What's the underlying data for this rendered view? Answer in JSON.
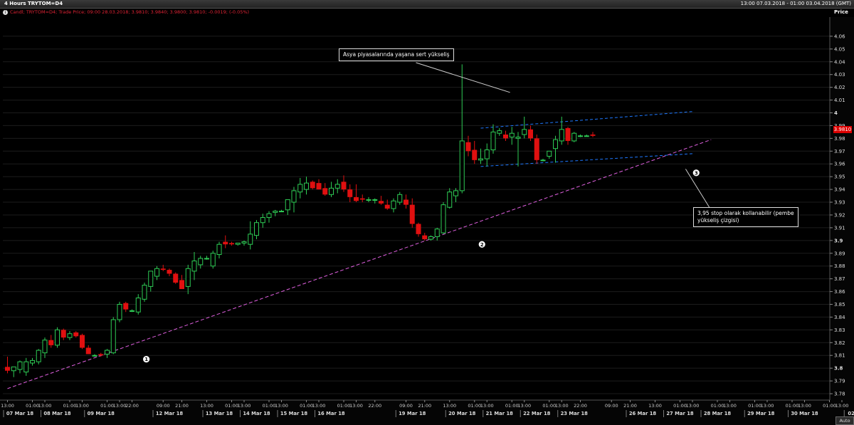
{
  "window": {
    "title": "4 Hours TRYTOM=D4",
    "range": "13:00 07.03.2018 - 01:00 03.04.2018 (GMT)"
  },
  "info_line": "Candl; TRYTOM=D4; Trade Price; 09:00 28.03.2018; 3.9810; 3.9840; 3.9800; 3.9810; -0.0019; (-0.05%)",
  "price_axis_label": "Price",
  "auto_button": "Auto",
  "last_price_label": "3.9810",
  "colors": {
    "up": "#2ecc55",
    "down": "#e01010",
    "trend": "#e060e0",
    "channel": "#1e78ff",
    "grid": "#1c1c1c"
  },
  "annotations": [
    {
      "text": "Asya piyasalarında yaşana sert yükseliş"
    },
    {
      "text": "3,95 stop olarak kollanabilir (pembe yükseliş çizgisi)"
    }
  ],
  "markers": [
    "1",
    "2",
    "3"
  ],
  "chart_data": {
    "type": "candlestick",
    "title": "4 Hours TRYTOM=D4",
    "xlabel": "",
    "ylabel": "Price",
    "ylim": [
      3.775,
      4.075
    ],
    "yticks": [
      3.78,
      3.79,
      3.8,
      3.81,
      3.82,
      3.83,
      3.84,
      3.85,
      3.86,
      3.87,
      3.88,
      3.89,
      3.9,
      3.91,
      3.92,
      3.93,
      3.94,
      3.95,
      3.96,
      3.97,
      3.98,
      3.99,
      4,
      4.01,
      4.02,
      4.03,
      4.04,
      4.05,
      4.06
    ],
    "ytick_labels": [
      "3.78",
      "3.79",
      "3.8",
      "3.81",
      "3.82",
      "3.83",
      "3.84",
      "3.85",
      "3.86",
      "3.87",
      "3.88",
      "3.89",
      "3.9",
      "3.91",
      "3.92",
      "3.93",
      "3.94",
      "3.95",
      "3.96",
      "3.97",
      "3.98",
      "3.99",
      "4",
      "4.01",
      "4.02",
      "4.03",
      "4.04",
      "4.05",
      "4.06"
    ],
    "x_time_labels": [
      [
        "13:00",
        0
      ],
      [
        "01:00",
        4
      ],
      [
        "13:00",
        6
      ],
      [
        "01:00",
        10
      ],
      [
        "13:00",
        12
      ],
      [
        "01:00",
        16
      ],
      [
        "13:00",
        18
      ],
      [
        "22:00",
        20
      ],
      [
        "09:00",
        25
      ],
      [
        "21:00",
        28
      ],
      [
        "13:00",
        32
      ],
      [
        "01:00",
        36
      ],
      [
        "13:00",
        38
      ],
      [
        "01:00",
        42
      ],
      [
        "13:00",
        44
      ],
      [
        "01:00",
        48
      ],
      [
        "13:00",
        50
      ],
      [
        "01:00",
        54
      ],
      [
        "13:00",
        56
      ],
      [
        "22:00",
        59
      ],
      [
        "09:00",
        64
      ],
      [
        "21:00",
        67
      ],
      [
        "13:00",
        71
      ],
      [
        "01:00",
        75
      ],
      [
        "13:00",
        77
      ],
      [
        "01:00",
        81
      ],
      [
        "13:00",
        83
      ],
      [
        "01:00",
        87
      ],
      [
        "13:00",
        89
      ],
      [
        "22:00",
        92
      ],
      [
        "09:00",
        97
      ],
      [
        "21:00",
        100
      ],
      [
        "13:00",
        104
      ],
      [
        "01:00",
        108
      ],
      [
        "13:00",
        110
      ],
      [
        "01:00",
        114
      ],
      [
        "13:00",
        116
      ],
      [
        "01:00",
        120
      ],
      [
        "13:00",
        122
      ],
      [
        "01:00",
        126
      ],
      [
        "13:00",
        128
      ],
      [
        "01:00",
        132
      ],
      [
        "13:00",
        134
      ],
      [
        "09:00",
        143
      ]
    ],
    "x_date_labels": [
      [
        "07 Mar 18",
        2
      ],
      [
        "08 Mar 18",
        8
      ],
      [
        "09 Mar 18",
        15
      ],
      [
        "12 Mar 18",
        26
      ],
      [
        "13 Mar 18",
        34
      ],
      [
        "14 Mar 18",
        40
      ],
      [
        "15 Mar 18",
        46
      ],
      [
        "16 Mar 18",
        52
      ],
      [
        "19 Mar 18",
        65
      ],
      [
        "20 Mar 18",
        73
      ],
      [
        "21 Mar 18",
        79
      ],
      [
        "22 Mar 18",
        85
      ],
      [
        "23 Mar 18",
        91
      ],
      [
        "26 Mar 18",
        102
      ],
      [
        "27 Mar 18",
        108
      ],
      [
        "28 Mar 18",
        114
      ],
      [
        "29 Mar 18",
        121
      ],
      [
        "30 Mar 18",
        128
      ],
      [
        "02 Nis 18",
        137
      ]
    ],
    "candles": [
      [
        3.801,
        3.809,
        3.796,
        3.798
      ],
      [
        3.798,
        3.801,
        3.793,
        3.801
      ],
      [
        3.799,
        3.806,
        3.796,
        3.805
      ],
      [
        3.797,
        3.808,
        3.794,
        3.805
      ],
      [
        3.804,
        3.808,
        3.802,
        3.806
      ],
      [
        3.805,
        3.815,
        3.803,
        3.814
      ],
      [
        3.812,
        3.824,
        3.808,
        3.822
      ],
      [
        3.822,
        3.826,
        3.816,
        3.818
      ],
      [
        3.818,
        3.832,
        3.816,
        3.83
      ],
      [
        3.83,
        3.831,
        3.822,
        3.824
      ],
      [
        3.824,
        3.829,
        3.822,
        3.827
      ],
      [
        3.828,
        3.829,
        3.824,
        3.825
      ],
      [
        3.826,
        3.827,
        3.815,
        3.816
      ],
      [
        3.816,
        3.818,
        3.811,
        3.811
      ],
      [
        3.81,
        3.811,
        3.809,
        3.81
      ],
      [
        3.811,
        3.812,
        3.809,
        3.81
      ],
      [
        3.811,
        3.815,
        3.808,
        3.814
      ],
      [
        3.812,
        3.84,
        3.811,
        3.838
      ],
      [
        3.838,
        3.852,
        3.836,
        3.85
      ],
      [
        3.851,
        3.852,
        3.844,
        3.846
      ],
      [
        3.845,
        3.846,
        3.844,
        3.845
      ],
      [
        3.844,
        3.858,
        3.842,
        3.855
      ],
      [
        3.854,
        3.867,
        3.852,
        3.865
      ],
      [
        3.864,
        3.876,
        3.86,
        3.876
      ],
      [
        3.872,
        3.88,
        3.869,
        3.878
      ],
      [
        3.878,
        3.881,
        3.876,
        3.877
      ],
      [
        3.877,
        3.878,
        3.872,
        3.874
      ],
      [
        3.874,
        3.875,
        3.866,
        3.867
      ],
      [
        3.869,
        3.873,
        3.862,
        3.862
      ],
      [
        3.864,
        3.881,
        3.858,
        3.878
      ],
      [
        3.876,
        3.891,
        3.869,
        3.884
      ],
      [
        3.881,
        3.888,
        3.878,
        3.886
      ],
      [
        3.886,
        3.888,
        3.885,
        3.886
      ],
      [
        3.88,
        3.892,
        3.878,
        3.89
      ],
      [
        3.889,
        3.899,
        3.886,
        3.897
      ],
      [
        3.899,
        3.904,
        3.894,
        3.897
      ],
      [
        3.898,
        3.899,
        3.896,
        3.897
      ],
      [
        3.897,
        3.898,
        3.896,
        3.898
      ],
      [
        3.898,
        3.9,
        3.896,
        3.899
      ],
      [
        3.897,
        3.915,
        3.893,
        3.905
      ],
      [
        3.904,
        3.916,
        3.901,
        3.914
      ],
      [
        3.914,
        3.921,
        3.91,
        3.918
      ],
      [
        3.918,
        3.923,
        3.914,
        3.921
      ],
      [
        3.922,
        3.924,
        3.919,
        3.923
      ],
      [
        3.923,
        3.924,
        3.923,
        3.923
      ],
      [
        3.924,
        3.932,
        3.92,
        3.932
      ],
      [
        3.93,
        3.942,
        3.922,
        3.939
      ],
      [
        3.938,
        3.949,
        3.933,
        3.944
      ],
      [
        3.94,
        3.95,
        3.936,
        3.945
      ],
      [
        3.946,
        3.947,
        3.94,
        3.941
      ],
      [
        3.945,
        3.948,
        3.94,
        3.94
      ],
      [
        3.941,
        3.945,
        3.935,
        3.936
      ],
      [
        3.936,
        3.946,
        3.934,
        3.941
      ],
      [
        3.941,
        3.948,
        3.937,
        3.944
      ],
      [
        3.946,
        3.951,
        3.938,
        3.94
      ],
      [
        3.94,
        3.944,
        3.93,
        3.934
      ],
      [
        3.934,
        3.944,
        3.93,
        3.931
      ],
      [
        3.933,
        3.936,
        3.93,
        3.932
      ],
      [
        3.932,
        3.934,
        3.93,
        3.932
      ],
      [
        3.932,
        3.933,
        3.929,
        3.932
      ],
      [
        3.931,
        3.935,
        3.928,
        3.929
      ],
      [
        3.928,
        3.932,
        3.924,
        3.925
      ],
      [
        3.925,
        3.933,
        3.922,
        3.931
      ],
      [
        3.93,
        3.938,
        3.928,
        3.936
      ],
      [
        3.932,
        3.936,
        3.925,
        3.928
      ],
      [
        3.928,
        3.933,
        3.91,
        3.913
      ],
      [
        3.913,
        3.914,
        3.903,
        3.905
      ],
      [
        3.904,
        3.906,
        3.9,
        3.901
      ],
      [
        3.901,
        3.904,
        3.9,
        3.903
      ],
      [
        3.903,
        3.91,
        3.9,
        3.909
      ],
      [
        3.906,
        3.93,
        3.905,
        3.928
      ],
      [
        3.926,
        3.941,
        3.925,
        3.938
      ],
      [
        3.935,
        3.941,
        3.93,
        3.939
      ],
      [
        3.939,
        4.038,
        3.937,
        3.978
      ],
      [
        3.977,
        3.982,
        3.966,
        3.97
      ],
      [
        3.971,
        3.978,
        3.96,
        3.963
      ],
      [
        3.963,
        3.972,
        3.96,
        3.964
      ],
      [
        3.964,
        3.976,
        3.958,
        3.971
      ],
      [
        3.971,
        3.991,
        3.968,
        3.985
      ],
      [
        3.984,
        3.988,
        3.982,
        3.986
      ],
      [
        3.983,
        3.986,
        3.978,
        3.98
      ],
      [
        3.981,
        3.989,
        3.975,
        3.984
      ],
      [
        3.98,
        3.985,
        3.958,
        3.981
      ],
      [
        3.983,
        3.997,
        3.98,
        3.987
      ],
      [
        3.987,
        3.99,
        3.978,
        3.98
      ],
      [
        3.98,
        3.983,
        3.96,
        3.963
      ],
      [
        3.963,
        3.964,
        3.962,
        3.963
      ],
      [
        3.966,
        3.97,
        3.964,
        3.97
      ],
      [
        3.972,
        3.982,
        3.961,
        3.979
      ],
      [
        3.978,
        3.997,
        3.975,
        3.987
      ],
      [
        3.988,
        3.989,
        3.975,
        3.978
      ],
      [
        3.978,
        3.985,
        3.977,
        3.984
      ],
      [
        3.982,
        3.983,
        3.981,
        3.982
      ],
      [
        3.982,
        3.983,
        3.982,
        3.982
      ],
      [
        3.983,
        3.985,
        3.981,
        3.982
      ]
    ],
    "candle_slots": [
      0,
      1,
      2,
      3,
      4,
      5,
      6,
      7,
      8,
      9,
      10,
      11,
      12,
      13,
      14,
      15,
      16,
      17,
      18,
      19,
      20,
      21,
      22,
      23,
      24,
      25,
      26,
      27,
      28,
      29,
      30,
      31,
      32,
      33,
      34,
      35,
      36,
      37,
      38,
      39,
      40,
      41,
      42,
      43,
      44,
      45,
      46,
      47,
      48,
      49,
      50,
      51,
      52,
      53,
      54,
      55,
      56,
      57,
      58,
      59,
      60,
      61,
      62,
      63,
      64,
      65,
      66,
      67,
      68,
      69,
      70,
      71,
      72,
      73,
      74,
      75,
      76,
      77,
      78,
      79,
      80,
      81,
      82,
      83,
      84,
      85,
      86,
      87,
      88,
      89,
      90,
      91,
      92,
      93,
      94
    ],
    "trendline": {
      "from": [
        0,
        3.784
      ],
      "to": [
        113,
        3.979
      ]
    },
    "channel_upper": {
      "from": [
        76,
        3.988
      ],
      "to": [
        110,
        4.001
      ]
    },
    "channel_lower": {
      "from": [
        76,
        3.958
      ],
      "to": [
        110,
        3.968
      ]
    }
  }
}
